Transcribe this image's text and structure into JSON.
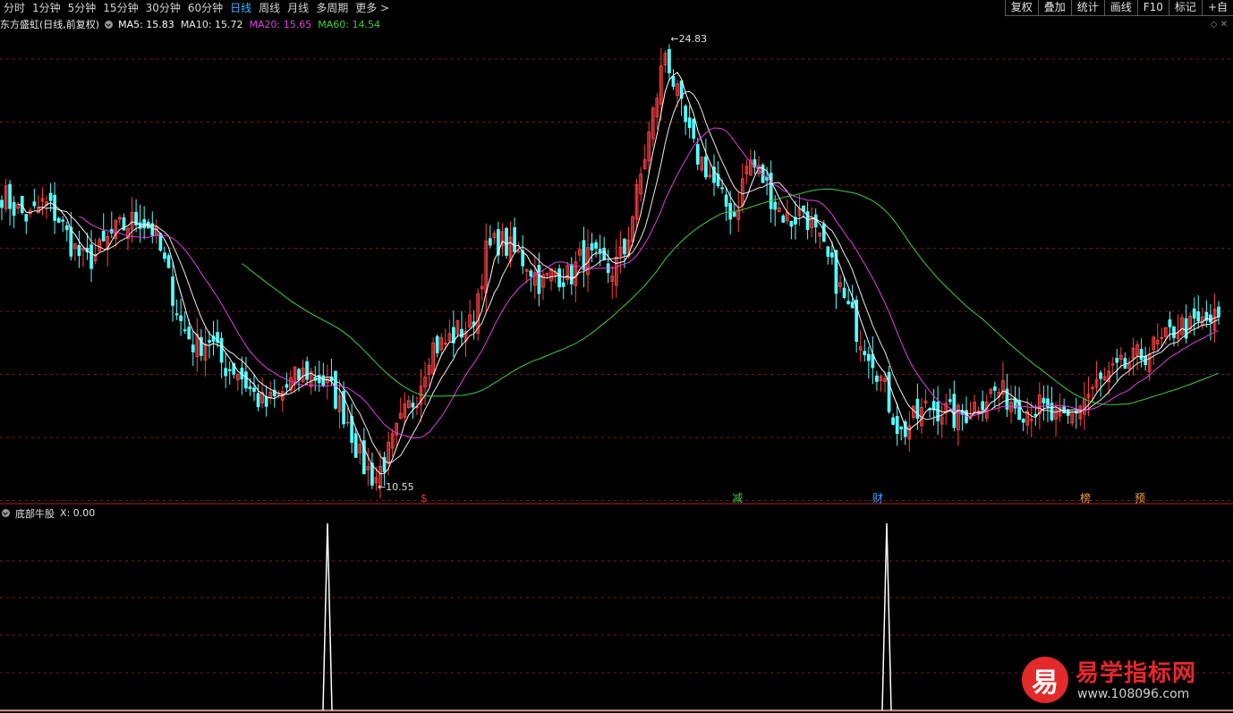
{
  "periods": [
    "分时",
    "1分钟",
    "5分钟",
    "15分钟",
    "30分钟",
    "60分钟",
    "日线",
    "周线",
    "月线",
    "多周期",
    "更多 >"
  ],
  "active_period": "日线",
  "right_buttons": [
    "复权",
    "叠加",
    "统计",
    "画线",
    "F10",
    "标记",
    "+自"
  ],
  "stock_label": "东方盛虹(日线,前复权)",
  "ma_labels": [
    {
      "text": "MA5: 15.83",
      "color": "#ffffff"
    },
    {
      "text": "MA10: 15.72",
      "color": "#e8e8e8"
    },
    {
      "text": "MA20: 15.65",
      "color": "#e040e0"
    },
    {
      "text": "MA60: 14.54",
      "color": "#40d040"
    }
  ],
  "high_label": "24.83",
  "low_label": "10.55",
  "event_markers": [
    {
      "text": "$",
      "color": "#e03030"
    },
    {
      "text": "减",
      "color": "#40d040"
    },
    {
      "text": "财",
      "color": "#40a0ff"
    },
    {
      "text": "榜",
      "color": "#f0a040"
    },
    {
      "text": "预",
      "color": "#f0a040"
    }
  ],
  "indicator_label": "底部牛股",
  "indicator_value": "X: 0.00",
  "logo": {
    "badge": "易",
    "title": "易学指标网",
    "url": "www.108096.com"
  },
  "chart_data": {
    "type": "candlestick",
    "ma_series": [
      {
        "name": "MA5",
        "color": "#ffffff"
      },
      {
        "name": "MA10",
        "color": "#e8e8e8"
      },
      {
        "name": "MA20",
        "color": "#e040e0"
      },
      {
        "name": "MA60",
        "color": "#40d040"
      }
    ],
    "close_path": [
      19.8,
      19.3,
      19.0,
      19.5,
      19.1,
      18.2,
      17.6,
      17.9,
      18.5,
      18.8,
      19.0,
      18.6,
      17.2,
      15.6,
      14.9,
      15.2,
      14.3,
      14.2,
      13.5,
      13.0,
      13.3,
      13.8,
      14.1,
      13.9,
      13.4,
      12.6,
      11.2,
      10.7,
      11.5,
      12.6,
      13.4,
      14.9,
      15.0,
      15.4,
      15.6,
      17.9,
      18.3,
      17.9,
      17.6,
      16.9,
      17.3,
      17.1,
      17.8,
      17.6,
      17.3,
      17.9,
      19.9,
      22.1,
      24.4,
      22.6,
      21.2,
      20.6,
      19.6,
      19.1,
      20.9,
      20.3,
      19.4,
      18.9,
      19.3,
      18.3,
      17.4,
      16.3,
      15.3,
      14.6,
      13.3,
      12.1,
      12.6,
      13.0,
      12.9,
      12.6,
      12.9,
      13.3,
      13.5,
      13.2,
      12.9,
      13.0,
      12.6,
      12.5,
      13.1,
      13.6,
      13.9,
      14.2,
      14.5,
      14.8,
      15.0,
      15.6,
      15.5,
      15.7,
      15.8
    ],
    "indicator_signals_index": [
      27,
      67
    ],
    "y_axis": {
      "max": 24.83,
      "min": 10.55
    }
  }
}
